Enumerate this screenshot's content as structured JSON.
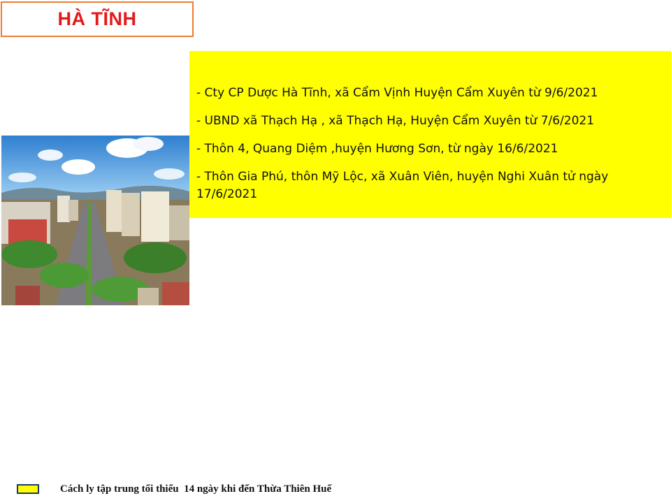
{
  "header": {
    "title": "HÀ TĨNH"
  },
  "photo": {
    "subject": "city-aerial-photo"
  },
  "panel": {
    "background": "#ffff00",
    "items": [
      "- Cty CP Dược Hà Tĩnh, xã Cẩm Vịnh Huyện Cẩm Xuyên từ 9/6/2021",
      "- UBND xã Thạch Hạ , xã Thạch Hạ, Huyện Cẩm Xuyên từ 7/6/2021",
      "- Thôn 4, Quang Diệm ,huyện Hương Sơn, từ ngày 16/6/2021",
      "- Thôn Gia Phú, thôn Mỹ Lộc, xã Xuân Viên, huyện Nghi Xuân tử ngày 17/6/2021"
    ]
  },
  "legend": {
    "swatch_color": "#ffff00",
    "text": "Cách ly tập trung tối thiểu  14 ngày khi đến Thừa Thiên Huế"
  },
  "colors": {
    "title_text": "#e31a1a",
    "title_border": "#ed7d31"
  }
}
